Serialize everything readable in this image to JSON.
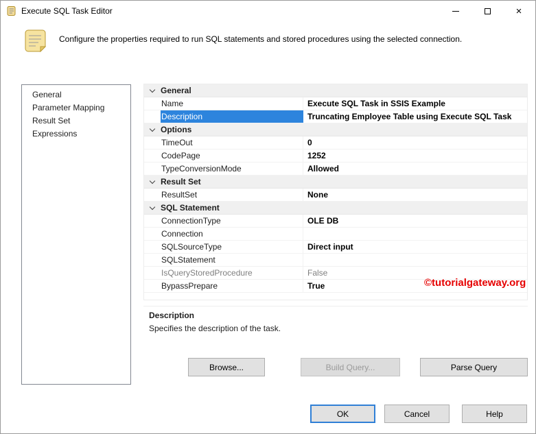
{
  "window": {
    "title": "Execute SQL Task Editor"
  },
  "header": {
    "description": "Configure the properties required to run SQL statements and stored procedures using the selected connection."
  },
  "sidebar": {
    "items": [
      {
        "label": "General"
      },
      {
        "label": "Parameter Mapping"
      },
      {
        "label": "Result Set"
      },
      {
        "label": "Expressions"
      }
    ]
  },
  "property_grid": {
    "rows": [
      {
        "type": "category",
        "label": "General",
        "expanded": true
      },
      {
        "type": "property",
        "name": "Name",
        "value": "Execute SQL Task in SSIS Example"
      },
      {
        "type": "property",
        "name": "Description",
        "value": "Truncating Employee Table using Execute SQL Task",
        "selected": true
      },
      {
        "type": "category",
        "label": "Options",
        "expanded": true
      },
      {
        "type": "property",
        "name": "TimeOut",
        "value": "0"
      },
      {
        "type": "property",
        "name": "CodePage",
        "value": "1252"
      },
      {
        "type": "property",
        "name": "TypeConversionMode",
        "value": "Allowed"
      },
      {
        "type": "category",
        "label": "Result Set",
        "expanded": true
      },
      {
        "type": "property",
        "name": "ResultSet",
        "value": "None"
      },
      {
        "type": "category",
        "label": "SQL Statement",
        "expanded": true
      },
      {
        "type": "property",
        "name": "ConnectionType",
        "value": "OLE DB"
      },
      {
        "type": "property",
        "name": "Connection",
        "value": ""
      },
      {
        "type": "property",
        "name": "SQLSourceType",
        "value": "Direct input"
      },
      {
        "type": "property",
        "name": "SQLStatement",
        "value": ""
      },
      {
        "type": "property",
        "name": "IsQueryStoredProcedure",
        "value": "False",
        "disabled": true
      },
      {
        "type": "property",
        "name": "BypassPrepare",
        "value": "True"
      }
    ]
  },
  "help_panel": {
    "title": "Description",
    "text": "Specifies the description of the task."
  },
  "watermark": {
    "text": "©tutorialgateway.org",
    "color": "#e60000"
  },
  "middle_buttons": [
    {
      "label": "Browse...",
      "enabled": true
    },
    {
      "label": "Build Query...",
      "enabled": false
    },
    {
      "label": "Parse Query",
      "enabled": true
    }
  ],
  "bottom_buttons": [
    {
      "label": "OK",
      "default": true
    },
    {
      "label": "Cancel",
      "default": false
    },
    {
      "label": "Help",
      "default": false
    }
  ],
  "colors": {
    "selection": "#2d84dd",
    "accent": "#2f7fd6"
  }
}
